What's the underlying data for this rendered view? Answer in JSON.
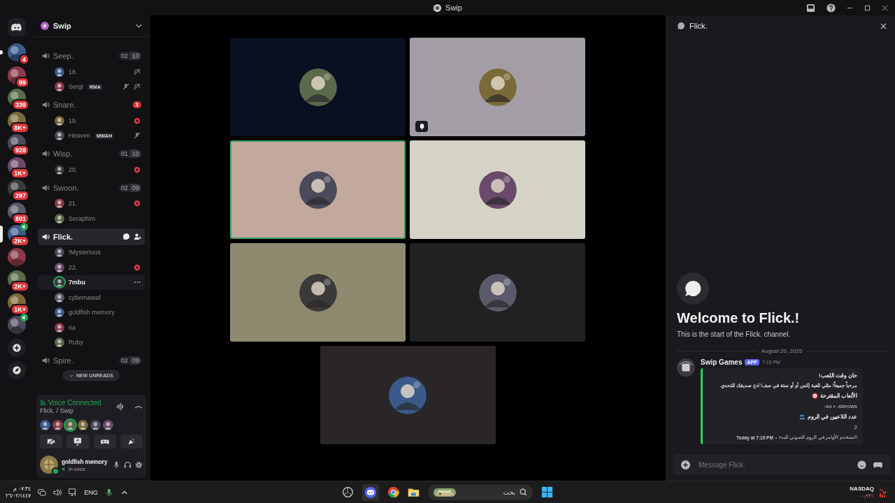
{
  "window": {
    "title": "Swip"
  },
  "servers": [
    {
      "badge": "4",
      "unread": true,
      "selected": false,
      "speaker": false
    },
    {
      "badge": "99",
      "unread": false,
      "selected": false,
      "speaker": false
    },
    {
      "badge": "339",
      "unread": false,
      "selected": false,
      "speaker": false
    },
    {
      "badge": "8K+",
      "unread": false,
      "selected": false,
      "speaker": false
    },
    {
      "badge": "928",
      "unread": false,
      "selected": false,
      "speaker": false
    },
    {
      "badge": "1K+",
      "unread": false,
      "selected": false,
      "speaker": false
    },
    {
      "badge": "297",
      "unread": false,
      "selected": false,
      "speaker": false
    },
    {
      "badge": "801",
      "unread": false,
      "selected": false,
      "speaker": false
    },
    {
      "badge": "2K+",
      "unread": false,
      "selected": true,
      "speaker": true
    },
    {
      "unread": false,
      "selected": false,
      "speaker": false
    },
    {
      "badge": "2K+",
      "unread": false,
      "selected": false,
      "speaker": false
    },
    {
      "badge": "1K+",
      "unread": false,
      "selected": false,
      "speaker": false
    },
    {
      "unread": false,
      "selected": false,
      "speaker": true
    }
  ],
  "server_header": {
    "name": "Swip"
  },
  "channels": [
    {
      "name": "Seep.",
      "selected": false,
      "counts": [
        "02",
        "10"
      ],
      "members": [
        {
          "name": "18.",
          "muted": false,
          "deafened": true,
          "activity": false,
          "hovered": false,
          "speaking": false
        },
        {
          "name": "Sergi",
          "tag": "RMA",
          "muted": true,
          "deafened": true,
          "activity": false,
          "hovered": false,
          "speaking": false
        }
      ]
    },
    {
      "name": "Snare.",
      "selected": false,
      "badge": "1",
      "members": [
        {
          "name": "19.",
          "muted": false,
          "deafened": false,
          "activity": true,
          "hovered": false,
          "speaking": false
        },
        {
          "name": "Heaven",
          "tag": "MWAH",
          "muted": true,
          "deafened": false,
          "activity": false,
          "hovered": false,
          "speaking": false
        }
      ]
    },
    {
      "name": "Wisp.",
      "selected": false,
      "counts": [
        "01",
        "10"
      ],
      "members": [
        {
          "name": "20.",
          "muted": false,
          "deafened": false,
          "activity": true,
          "hovered": false,
          "speaking": false
        }
      ]
    },
    {
      "name": "Swoon.",
      "selected": false,
      "counts": [
        "02",
        "09"
      ],
      "members": [
        {
          "name": "21.",
          "muted": false,
          "deafened": false,
          "activity": true,
          "hovered": false,
          "speaking": false
        },
        {
          "name": "Seraphim",
          "muted": false,
          "deafened": false,
          "activity": false,
          "hovered": false,
          "speaking": false
        }
      ]
    },
    {
      "name": "Flick.",
      "selected": true,
      "members": [
        {
          "name": "!Mysterious",
          "muted": false,
          "deafened": false,
          "activity": false,
          "hovered": false,
          "speaking": false
        },
        {
          "name": "22.",
          "muted": false,
          "deafened": false,
          "activity": true,
          "hovered": false,
          "speaking": false
        },
        {
          "name": "7mbu",
          "muted": false,
          "deafened": false,
          "activity": false,
          "hovered": true,
          "speaking": true
        },
        {
          "name": "cybernawaf",
          "muted": false,
          "deafened": false,
          "activity": false,
          "hovered": false,
          "speaking": false
        },
        {
          "name": "goldfish memory",
          "muted": false,
          "deafened": false,
          "activity": false,
          "hovered": false,
          "speaking": false
        },
        {
          "name": "ria",
          "muted": false,
          "deafened": false,
          "activity": false,
          "hovered": false,
          "speaking": false
        },
        {
          "name": "Ruby",
          "muted": false,
          "deafened": false,
          "activity": false,
          "hovered": false,
          "speaking": false
        }
      ]
    },
    {
      "name": "Spire.",
      "selected": false,
      "counts": [
        "02",
        "09"
      ]
    }
  ],
  "new_unreads": "NEW UNREADS",
  "voice_panel": {
    "status": "Voice Connected",
    "location": "Flick. / Swip",
    "user": {
      "name": "goldfish memory",
      "status": "In voice"
    }
  },
  "video_tiles": [
    {
      "color": "#0b0f22",
      "speaking": false,
      "activity": false
    },
    {
      "color": "#a39ea6",
      "speaking": false,
      "activity": true
    },
    {
      "color": "#c2a89d",
      "speaking": true,
      "activity": false
    },
    {
      "color": "#d5d3c5",
      "speaking": false,
      "activity": false
    },
    {
      "color": "#8e8a6f",
      "speaking": false,
      "activity": false
    },
    {
      "color": "#212121",
      "speaking": false,
      "activity": false
    },
    {
      "color": "#2a2627",
      "speaking": false,
      "activity": false
    }
  ],
  "chat": {
    "title": "Flick.",
    "welcome_title": "Welcome to Flick.!",
    "welcome_text": "This is the start of the Flick. channel.",
    "date": "August 20, 2025",
    "message": {
      "author": "Swip Games",
      "badge": "APP",
      "time": "7:19 PM",
      "embed": {
        "title": "حان وقت اللعب!",
        "description": "مرحباً جميعاً! مثلي للعبة إكس أو أو ستة في صف! ادع صديقك للتحدي.",
        "fields": [
          {
            "name": "الألعاب المقترحة",
            "value": "-xo • -sixrows"
          },
          {
            "name": "عدد اللاعبين في الروم",
            "value": "2"
          }
        ],
        "footer": "استخدم الأوامر في الروم الصوتي للبدء!",
        "footer_separator": "•",
        "footer_time": "Today at 7:19 PM"
      }
    },
    "placeholder": "Message Flick."
  },
  "taskbar": {
    "time": "٠٧:٣٤ م",
    "date": "٢٦/٠٢/١٤٤٧",
    "language": "ENG",
    "search_placeholder": "بحث",
    "ticker": {
      "name": "NASDAQ",
      "change": "-٠٫٩٣٪"
    }
  }
}
